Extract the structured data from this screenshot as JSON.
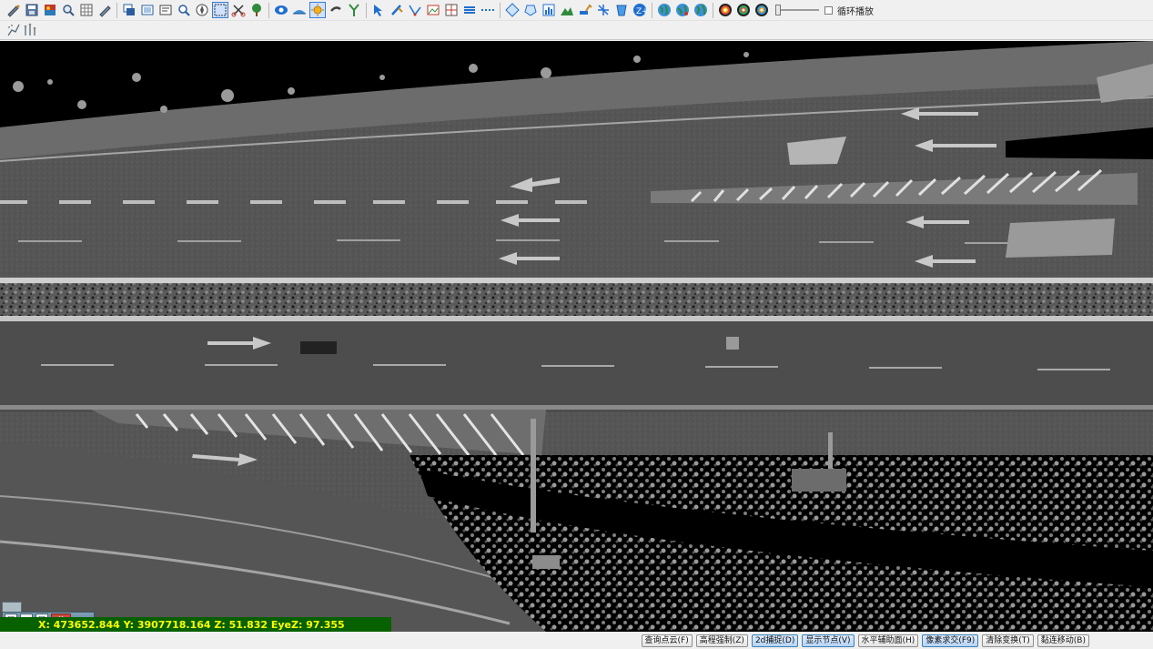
{
  "toolbar": {
    "loop_play_label": "循环播放",
    "loop_play_checked": false,
    "playback_slider_value": 0.0,
    "tools": [
      "edit-icon",
      "save-icon",
      "layer-map-icon",
      "zoom-icon",
      "grid-icon",
      "pen-icon",
      "copy-window-icon",
      "screen-icon",
      "measure-icon",
      "search-icon",
      "compass-icon",
      "select-box-icon",
      "cut-icon",
      "tree-icon",
      "eye-icon",
      "road-profile-icon",
      "sun-icon",
      "wrench-icon",
      "y-split-icon",
      "arrow-cursor-icon",
      "brush-icon",
      "line-edit-icon",
      "image-icon",
      "grid-edit-icon",
      "layers-icon",
      "dash-line-icon",
      "diamond-icon",
      "polygon-icon",
      "spreadsheet-icon",
      "terrain-icon",
      "excavator-icon",
      "scissors-icon",
      "cup-icon",
      "z-plus-icon",
      "globe-1-icon",
      "globe-2-icon",
      "globe-3-icon",
      "target-1-icon",
      "target-2-icon",
      "target-3-icon"
    ],
    "sub_tools": [
      "point-cloud-tool-1-icon",
      "point-cloud-tool-2-icon"
    ]
  },
  "viewport": {
    "coordinates_label": "X: 473652.844 Y: 3907718.164 Z: 51.832 EyeZ: 97.355"
  },
  "status_bar": {
    "buttons": [
      {
        "label": "查询点云(F)",
        "active": false
      },
      {
        "label": "高程强制(Z)",
        "active": false
      },
      {
        "label": "2d捕捉(D)",
        "active": true
      },
      {
        "label": "显示节点(V)",
        "active": true
      },
      {
        "label": "水平辅助面(H)",
        "active": false
      },
      {
        "label": "像素求交(F9)",
        "active": true
      },
      {
        "label": "清除变换(T)",
        "active": false
      },
      {
        "label": "黏连移动(B)",
        "active": false
      }
    ]
  }
}
